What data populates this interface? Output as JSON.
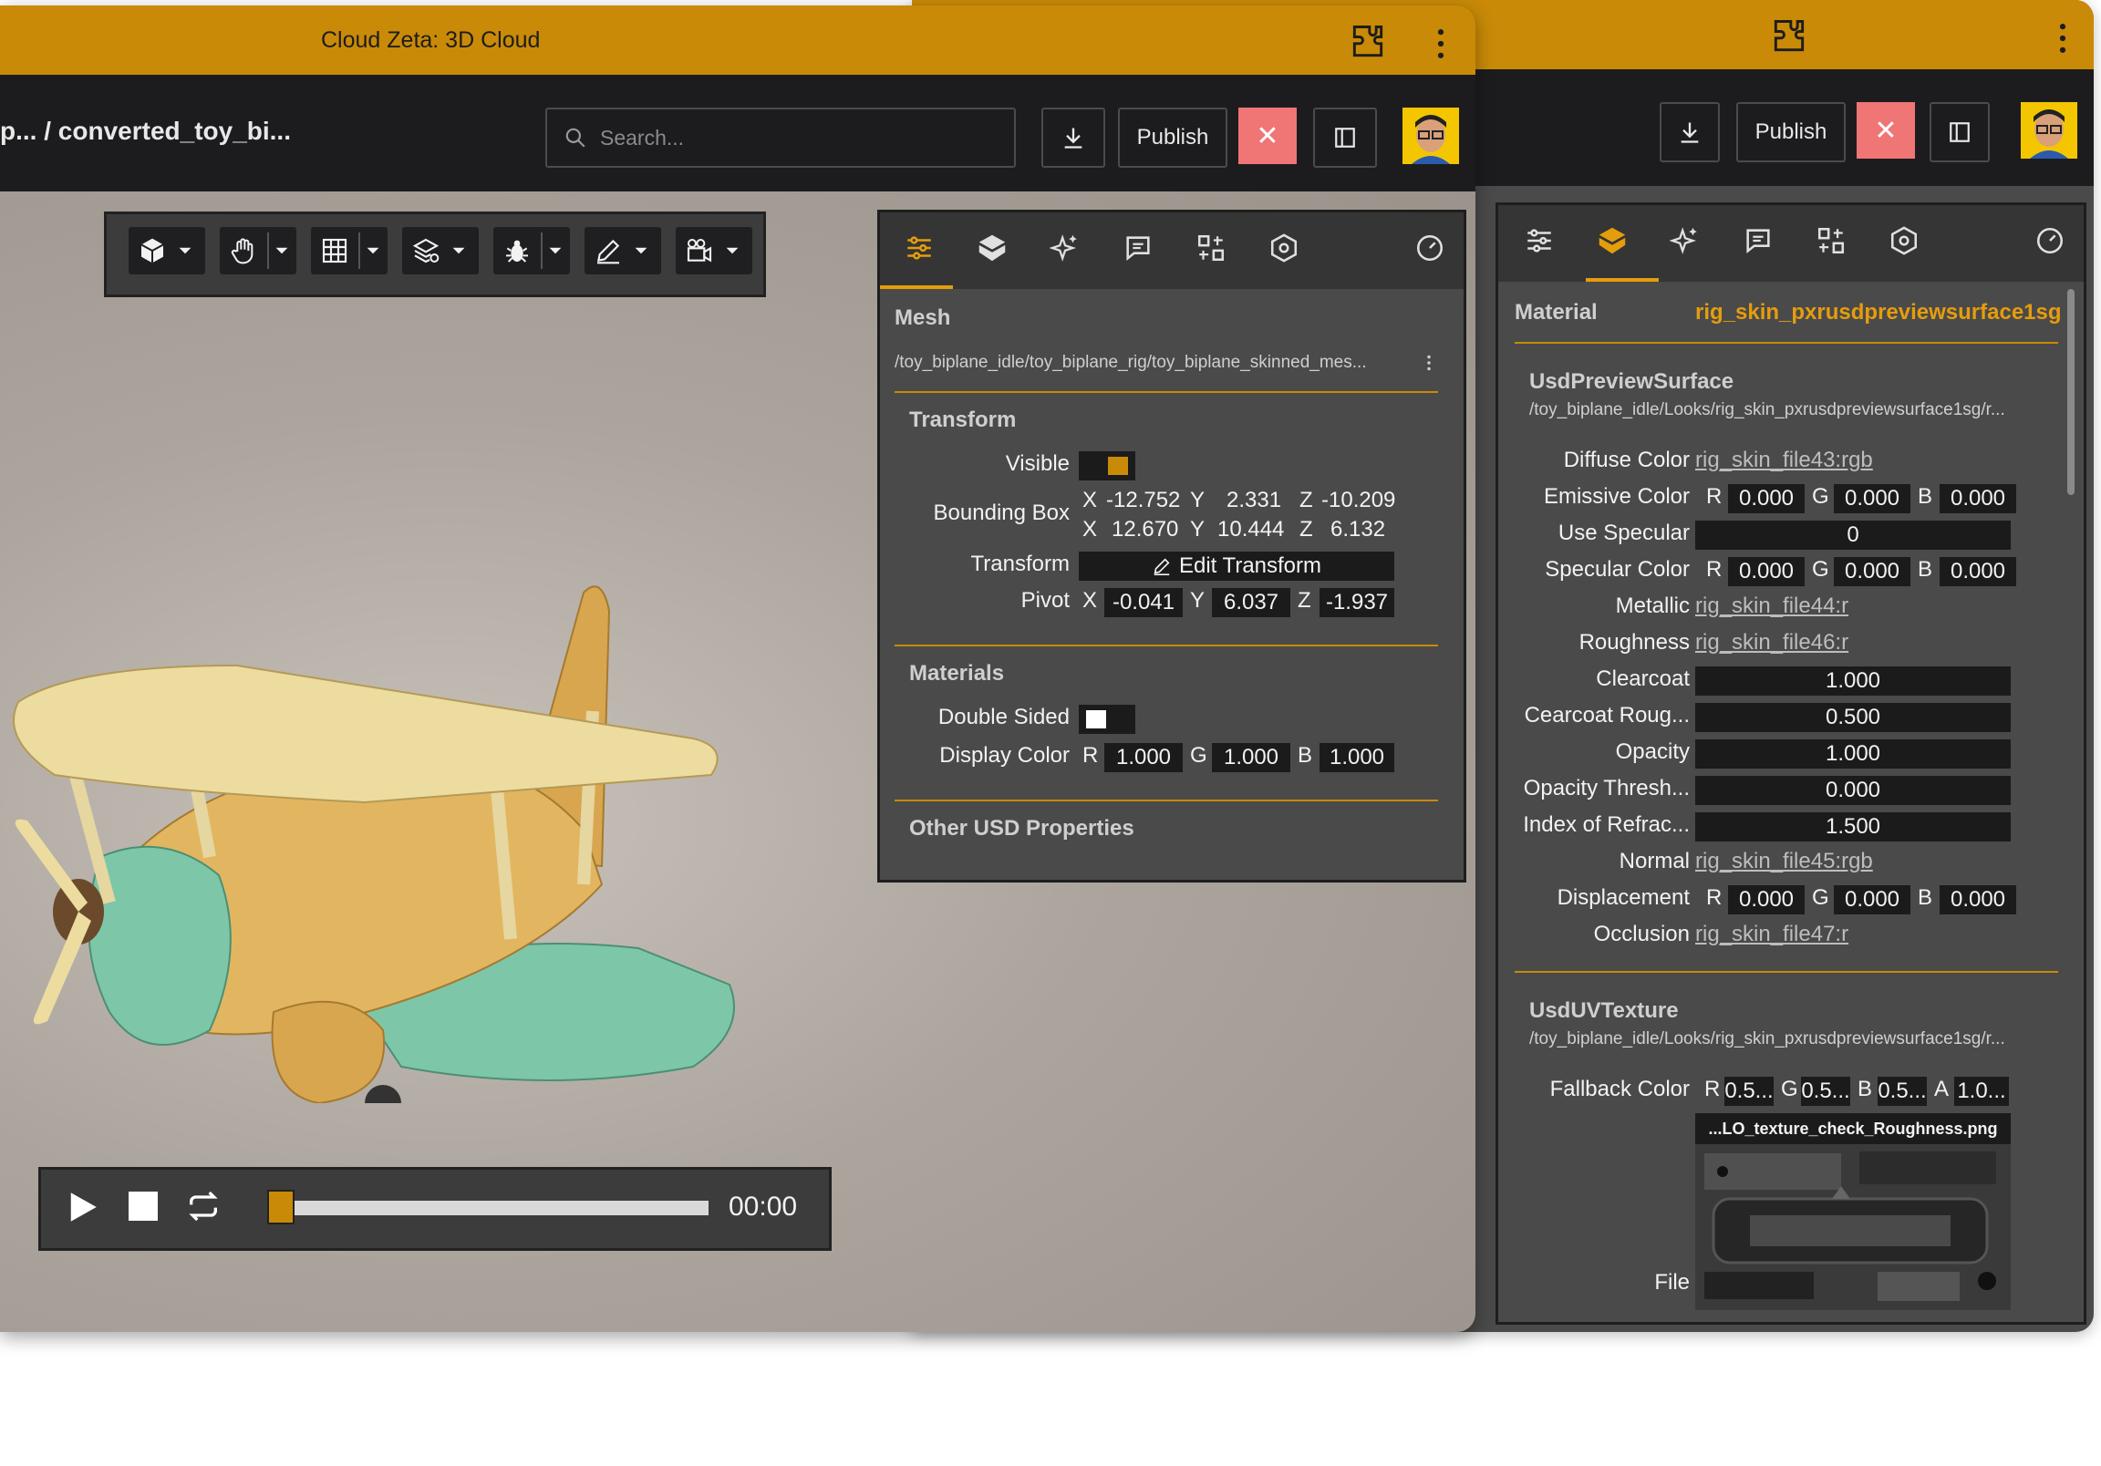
{
  "window": {
    "title": "Cloud Zeta: 3D Cloud"
  },
  "header": {
    "breadcrumb_prefix": "p...",
    "breadcrumb_sep": "/",
    "breadcrumb_current": "converted_toy_bi...",
    "search_placeholder": "Search...",
    "publish_label": "Publish",
    "close_glyph": "✕"
  },
  "viewport_toolbar": {
    "tools": [
      "cube-icon",
      "hand-icon",
      "grid-icon",
      "layers-icon",
      "bug-icon",
      "pen-icon",
      "camera-icon"
    ]
  },
  "mesh_panel": {
    "heading": "Mesh",
    "path": "/toy_biplane_idle/toy_biplane_rig/toy_biplane_skinned_mes...",
    "transform_section": "Transform",
    "visible_label": "Visible",
    "bbox_label": "Bounding Box",
    "bbox_min": {
      "x": "-12.752",
      "y": "2.331",
      "z": "-10.209"
    },
    "bbox_max": {
      "x": "12.670",
      "y": "10.444",
      "z": "6.132"
    },
    "transform_label": "Transform",
    "edit_transform": "Edit Transform",
    "pivot_label": "Pivot",
    "pivot": {
      "x": "-0.041",
      "y": "6.037",
      "z": "-1.937"
    },
    "materials_section": "Materials",
    "double_sided_label": "Double Sided",
    "display_color_label": "Display Color",
    "display_color": {
      "r": "1.000",
      "g": "1.000",
      "b": "1.000"
    },
    "other_section": "Other USD Properties"
  },
  "axis_letters": {
    "x": "X",
    "y": "Y",
    "z": "Z",
    "r": "R",
    "g": "G",
    "b": "B",
    "a": "A"
  },
  "player": {
    "time": "00:00",
    "progress": 0.0
  },
  "material_panel": {
    "heading": "Material",
    "material_name": "rig_skin_pxrusdpreviewsurface1sg",
    "surface_section": "UsdPreviewSurface",
    "surface_path": "/toy_biplane_idle/Looks/rig_skin_pxrusdpreviewsurface1sg/r...",
    "diffuse_label": "Diffuse Color",
    "diffuse_link": "rig_skin_file43:rgb",
    "emissive_label": "Emissive Color",
    "emissive": {
      "r": "0.000",
      "g": "0.000",
      "b": "0.000"
    },
    "use_specular_label": "Use Specular",
    "use_specular": "0",
    "specular_label": "Specular Color",
    "specular": {
      "r": "0.000",
      "g": "0.000",
      "b": "0.000"
    },
    "metallic_label": "Metallic",
    "metallic_link": "rig_skin_file44:r",
    "roughness_label": "Roughness",
    "roughness_link": "rig_skin_file46:r",
    "clearcoat_label": "Clearcoat",
    "clearcoat": "1.000",
    "clearcoat_rough_label": "Cearcoat Roug...",
    "clearcoat_rough": "0.500",
    "opacity_label": "Opacity",
    "opacity": "1.000",
    "opacity_thresh_label": "Opacity Thresh...",
    "opacity_thresh": "0.000",
    "ior_label": "Index of Refrac...",
    "ior": "1.500",
    "normal_label": "Normal",
    "normal_link": "rig_skin_file45:rgb",
    "displacement_label": "Displacement",
    "displacement": {
      "r": "0.000",
      "g": "0.000",
      "b": "0.000"
    },
    "occlusion_label": "Occlusion",
    "occlusion_link": "rig_skin_file47:r",
    "texture_section": "UsdUVTexture",
    "texture_path": "/toy_biplane_idle/Looks/rig_skin_pxrusdpreviewsurface1sg/r...",
    "fallback_label": "Fallback Color",
    "fallback": {
      "r": "0.5...",
      "g": "0.5...",
      "b": "0.5...",
      "a": "1.0..."
    },
    "file_label": "File",
    "file_name": "...LO_texture_check_Roughness.png"
  },
  "colors": {
    "accent": "#c98a07",
    "active_tab": "#e59d0c",
    "close_button": "#f07575",
    "visible_swatch": "#c98a07"
  }
}
